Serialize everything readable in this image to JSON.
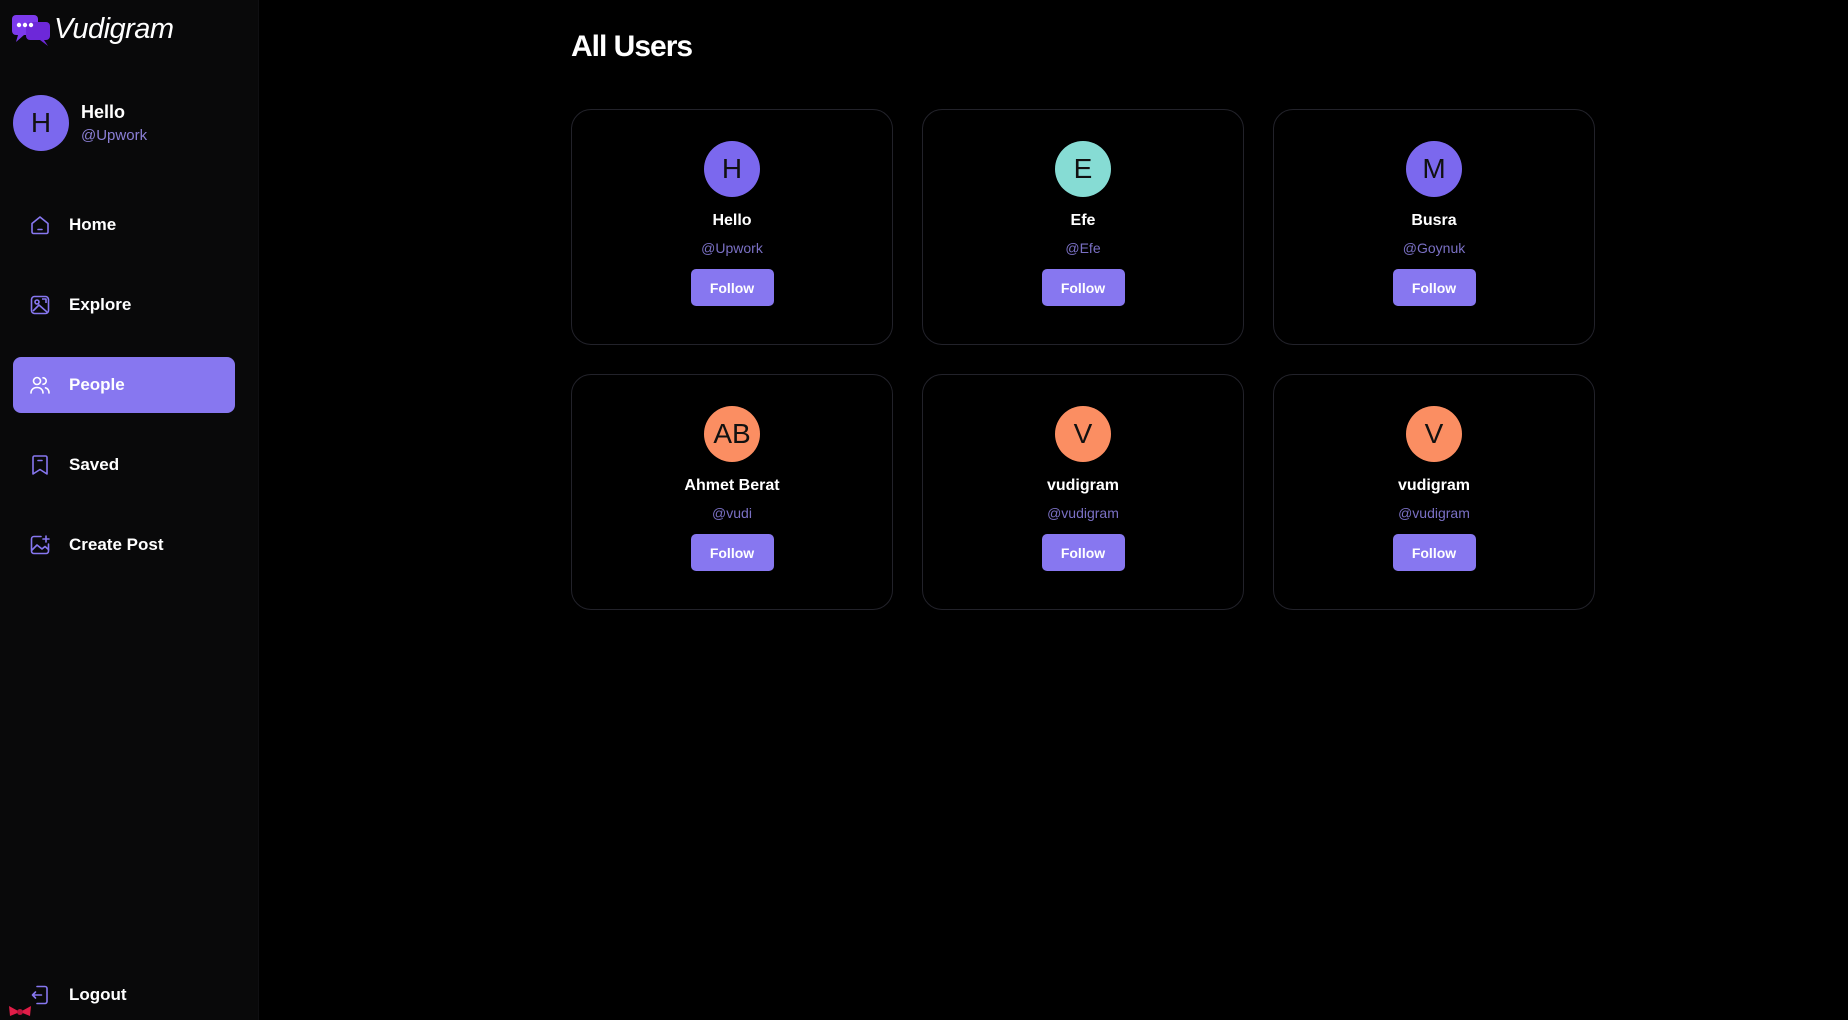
{
  "app": {
    "name": "Vudigram",
    "brand_color": "#8777f0"
  },
  "profile": {
    "initial": "H",
    "name": "Hello",
    "handle": "@Upwork",
    "avatar_color": "#7b68ee"
  },
  "nav": {
    "items": [
      {
        "label": "Home",
        "icon": "home-icon",
        "active": false
      },
      {
        "label": "Explore",
        "icon": "explore-icon",
        "active": false
      },
      {
        "label": "People",
        "icon": "people-icon",
        "active": true
      },
      {
        "label": "Saved",
        "icon": "bookmark-icon",
        "active": false
      },
      {
        "label": "Create Post",
        "icon": "create-post-icon",
        "active": false
      }
    ],
    "logout_label": "Logout"
  },
  "main": {
    "title": "All Users",
    "users": [
      {
        "initial": "H",
        "name": "Hello",
        "handle": "@Upwork",
        "avatar_color": "#7b68ee",
        "button": "Follow"
      },
      {
        "initial": "E",
        "name": "Efe",
        "handle": "@Efe",
        "avatar_color": "#86dcd4",
        "button": "Follow"
      },
      {
        "initial": "M",
        "name": "Busra",
        "handle": "@Goynuk",
        "avatar_color": "#7b68ee",
        "button": "Follow"
      },
      {
        "initial": "AB",
        "name": "Ahmet Berat",
        "handle": "@vudi",
        "avatar_color": "#fb8e62",
        "button": "Follow"
      },
      {
        "initial": "V",
        "name": "vudigram",
        "handle": "@vudigram",
        "avatar_color": "#fb8e62",
        "button": "Follow"
      },
      {
        "initial": "V",
        "name": "vudigram",
        "handle": "@vudigram",
        "avatar_color": "#fb8e62",
        "button": "Follow"
      }
    ]
  }
}
